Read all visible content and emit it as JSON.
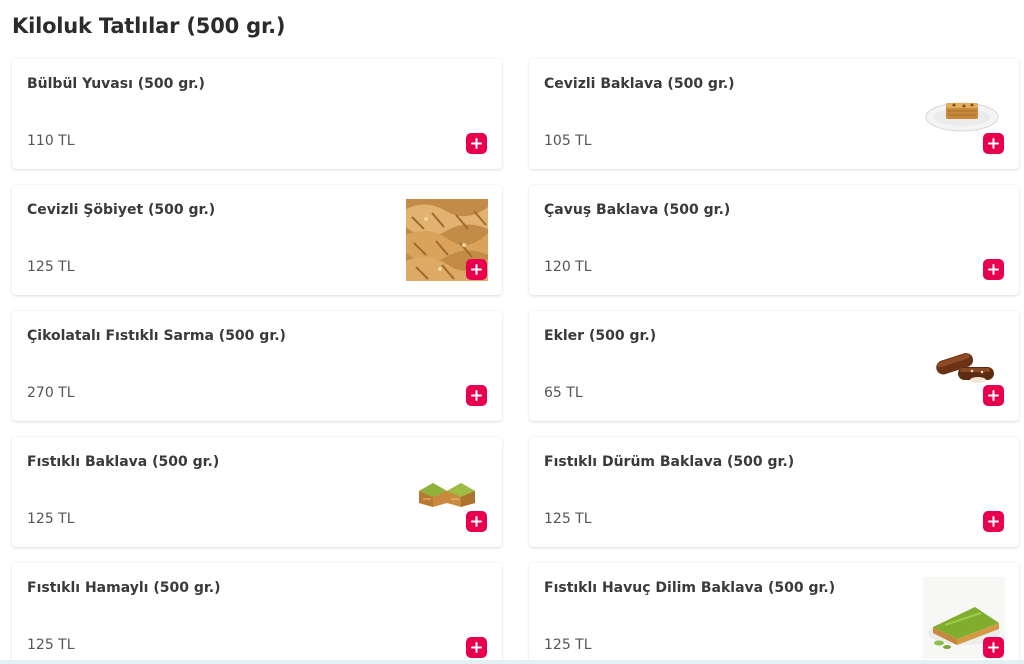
{
  "section": {
    "title": "Kiloluk Tatlılar (500 gr.)"
  },
  "products": [
    {
      "name": "Bülbül Yuvası (500 gr.)",
      "price": "110 TL"
    },
    {
      "name": "Cevizli Baklava (500 gr.)",
      "price": "105 TL"
    },
    {
      "name": "Cevizli Şöbiyet (500 gr.)",
      "price": "125 TL"
    },
    {
      "name": "Çavuş Baklava (500 gr.)",
      "price": "120 TL"
    },
    {
      "name": "Çikolatalı Fıstıklı Sarma (500 gr.)",
      "price": "270 TL"
    },
    {
      "name": "Ekler (500 gr.)",
      "price": "65 TL"
    },
    {
      "name": "Fıstıklı Baklava (500 gr.)",
      "price": "125 TL"
    },
    {
      "name": "Fıstıklı Dürüm Baklava (500 gr.)",
      "price": "125 TL"
    },
    {
      "name": "Fıstıklı Hamaylı (500 gr.)",
      "price": "125 TL"
    },
    {
      "name": "Fıstıklı Havuç Dilim Baklava (500 gr.)",
      "price": "125 TL"
    }
  ],
  "icons": {
    "add": "plus-icon"
  },
  "colors": {
    "accent": "#e8004f",
    "background": "#ffffff",
    "title": "#2b2b2b"
  }
}
